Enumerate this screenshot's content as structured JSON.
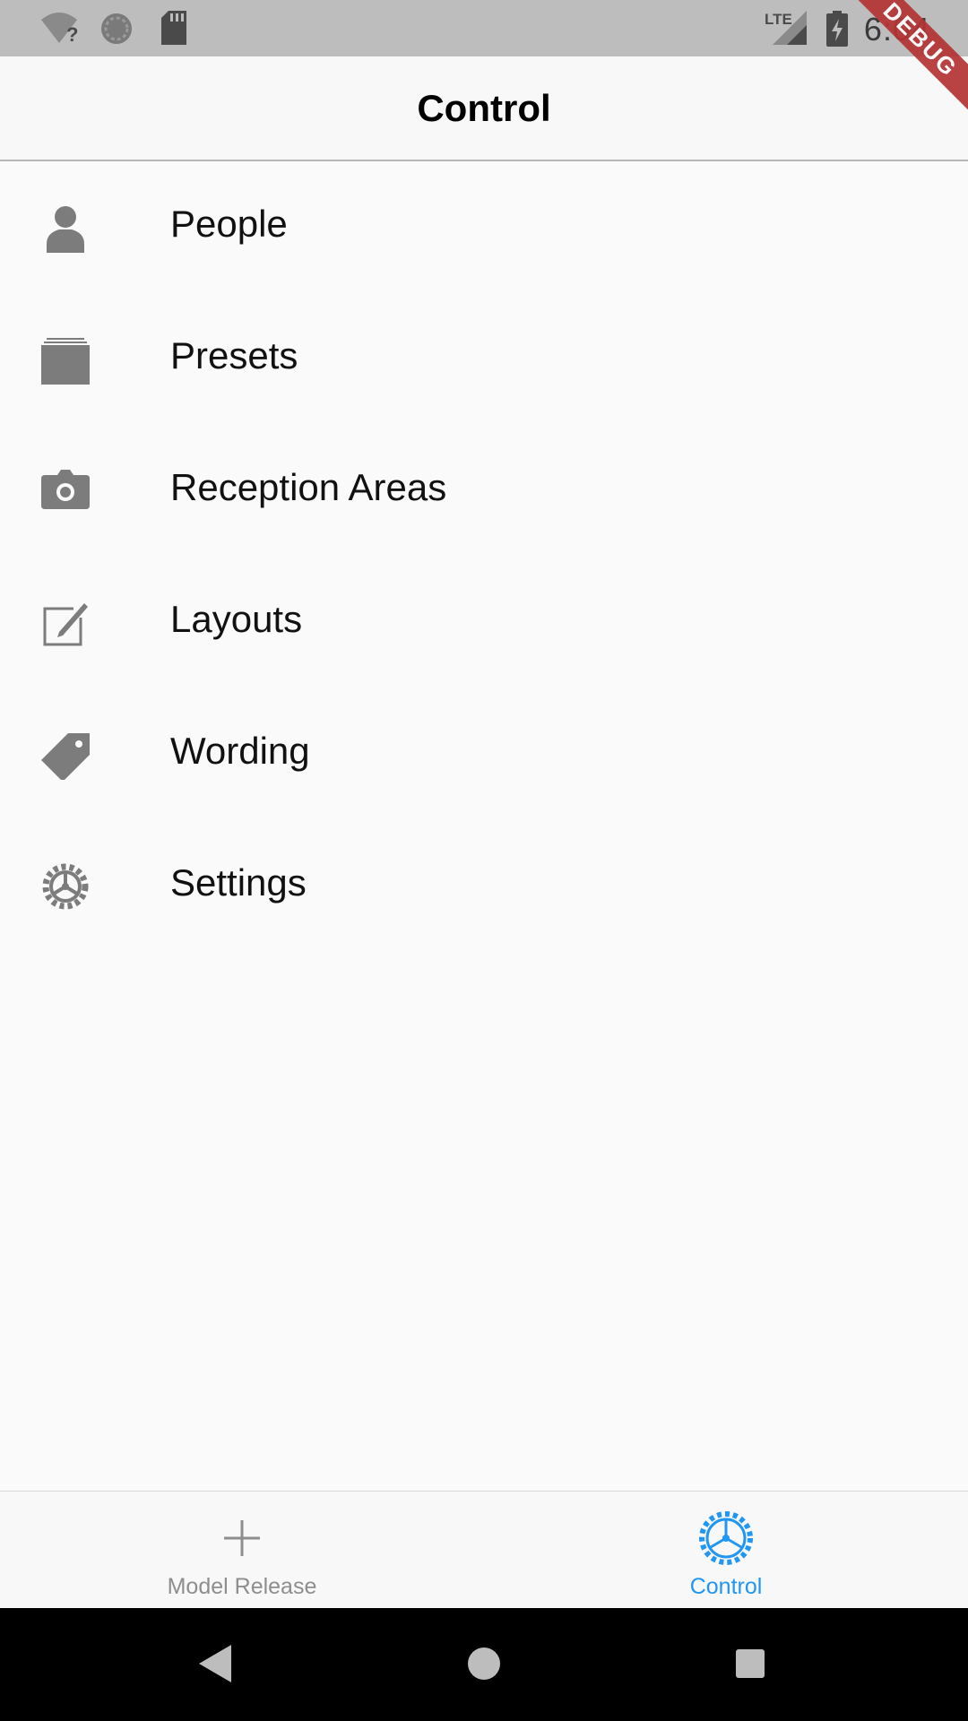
{
  "status_bar": {
    "time": "6:04",
    "network_label": "LTE",
    "debug_banner": "DEBUG",
    "icons": [
      "wifi-unknown-icon",
      "sync-icon",
      "sd-card-icon",
      "signal-icon",
      "battery-charging-icon"
    ]
  },
  "app_bar": {
    "title": "Control"
  },
  "menu": {
    "items": [
      {
        "label": "People",
        "icon": "person-icon"
      },
      {
        "label": "Presets",
        "icon": "stack-icon"
      },
      {
        "label": "Reception Areas",
        "icon": "camera-icon"
      },
      {
        "label": "Layouts",
        "icon": "edit-icon"
      },
      {
        "label": "Wording",
        "icon": "tag-icon"
      },
      {
        "label": "Settings",
        "icon": "gear-icon"
      }
    ]
  },
  "tab_bar": {
    "tabs": [
      {
        "label": "Model Release",
        "icon": "plus-icon",
        "active": false
      },
      {
        "label": "Control",
        "icon": "gear-outline-icon",
        "active": true
      }
    ],
    "colors": {
      "active": "#2196f3",
      "inactive": "#8e8e8e"
    }
  },
  "nav_bar": {
    "buttons": [
      "back-icon",
      "home-icon",
      "recents-icon"
    ]
  }
}
